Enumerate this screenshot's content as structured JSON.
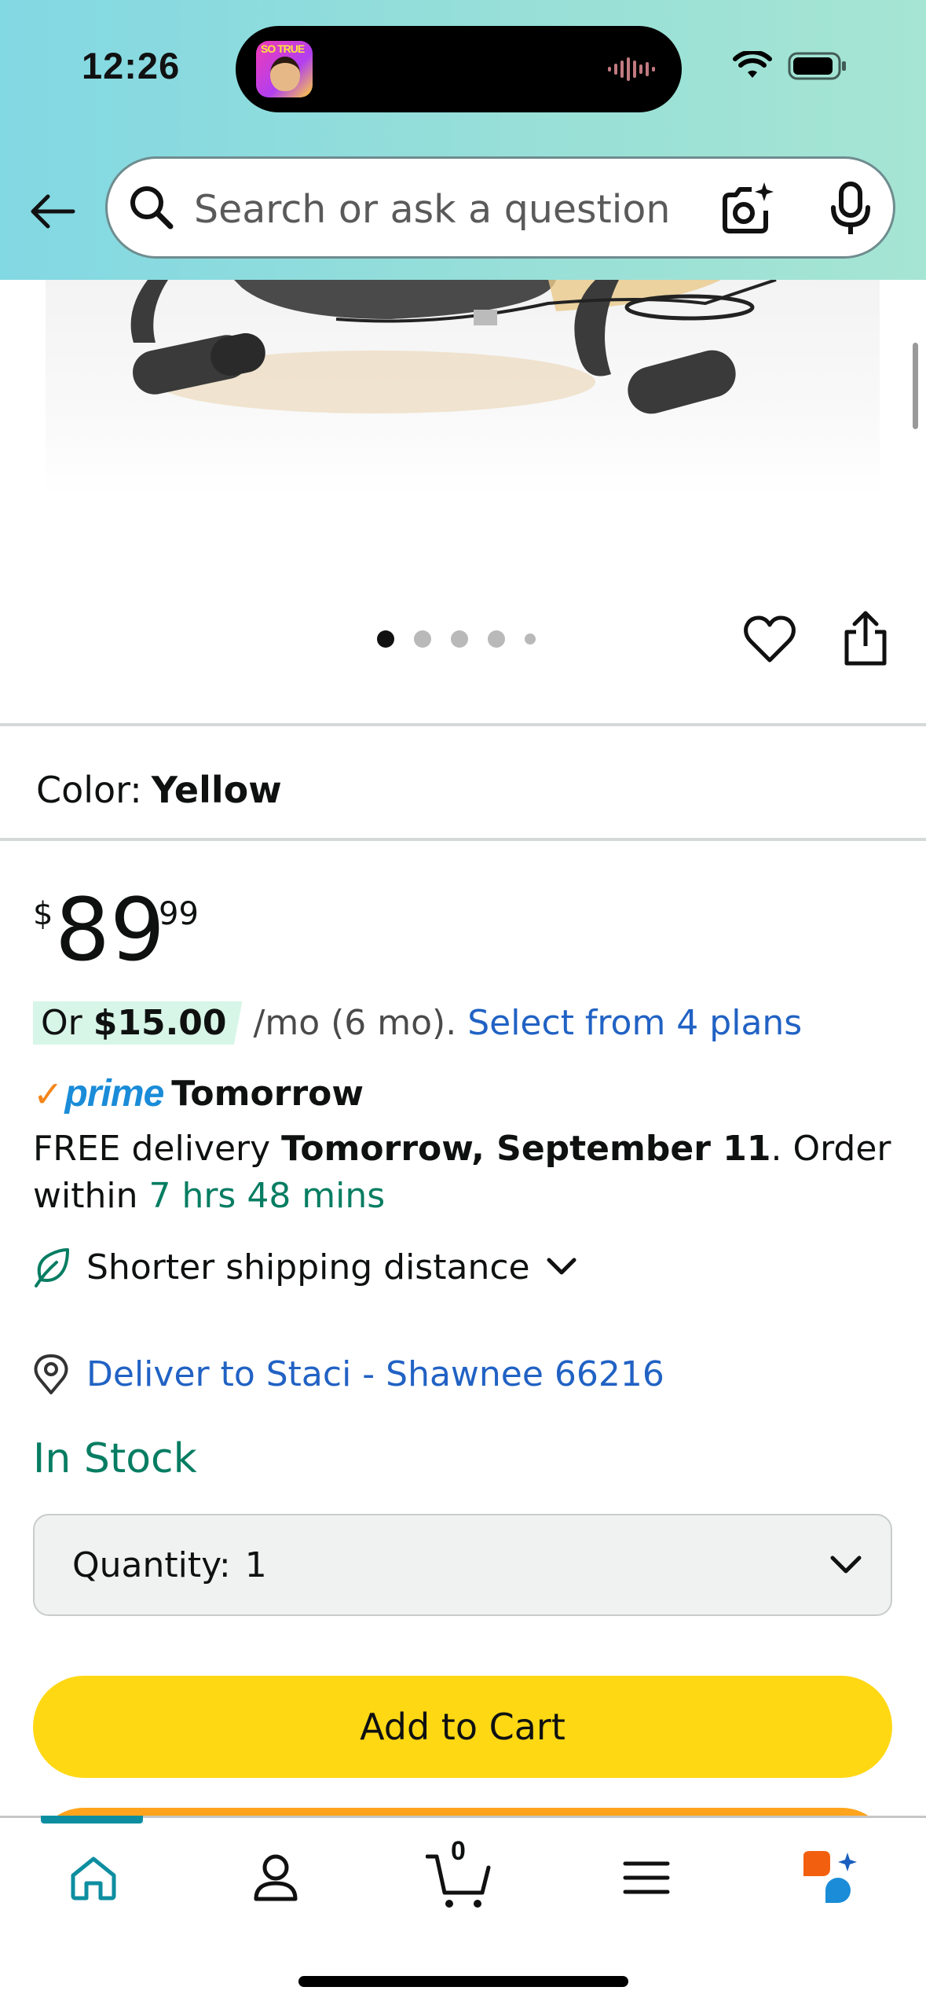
{
  "status_bar": {
    "time": "12:26",
    "island_thumb_text": "SO TRUE"
  },
  "header": {
    "search_placeholder": "Search or ask a question",
    "colors": {
      "gradient_start": "#82d8e3",
      "gradient_end": "#a6e5d3"
    }
  },
  "gallery": {
    "image_count": 5,
    "active_index": 0
  },
  "product": {
    "color_label": "Color:",
    "color_value": "Yellow",
    "price_symbol": "$",
    "price_whole": "89",
    "price_fraction": "99",
    "installment_prefix": "Or",
    "installment_amount": "$15.00",
    "installment_term": "/mo (6 mo).",
    "installment_link": "Select from 4 plans",
    "prime_check": "✓",
    "prime_logo": "prime",
    "prime_speed": "Tomorrow",
    "delivery_prefix": "FREE delivery",
    "delivery_date": "Tomorrow, September 11",
    "delivery_order": ". Order within",
    "delivery_countdown": "7 hrs 48 mins",
    "shipping_note": "Shorter shipping distance",
    "deliver_to": "Deliver to Staci - Shawnee 66216",
    "stock_status": "In Stock",
    "quantity_label": "Quantity:",
    "quantity_value": "1",
    "add_to_cart": "Add to Cart"
  },
  "bottom_nav": {
    "cart_count": "0",
    "active_tab": "home",
    "colors": {
      "active": "#0d8ea0"
    }
  }
}
